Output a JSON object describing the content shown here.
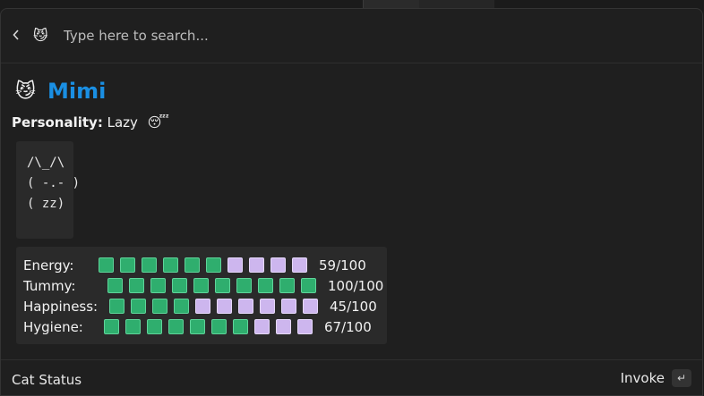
{
  "search": {
    "placeholder": "Type here to search...",
    "extension_icon": "😼"
  },
  "details": {
    "title_icon": "😼",
    "title": "Mimi",
    "personality_label": "Personality:",
    "personality_value": "Lazy",
    "personality_emoji": "😴",
    "ascii_art": "/\\_/\\\n( -.- )\n( zz)",
    "stats": [
      {
        "label": "Energy:",
        "filled": 6,
        "total": 10,
        "value": "59/100"
      },
      {
        "label": "Tummy:",
        "filled": 10,
        "total": 10,
        "value": "100/100"
      },
      {
        "label": "Happiness:",
        "filled": 4,
        "total": 10,
        "value": "45/100"
      },
      {
        "label": "Hygiene:",
        "filled": 7,
        "total": 10,
        "value": "67/100"
      }
    ]
  },
  "footer": {
    "title": "Cat Status",
    "action_label": "Invoke",
    "action_key": "↵"
  },
  "colors": {
    "accent": "#1a8fe3",
    "bar_full": "#2fae6e",
    "bar_empty": "#cdb6ee"
  }
}
